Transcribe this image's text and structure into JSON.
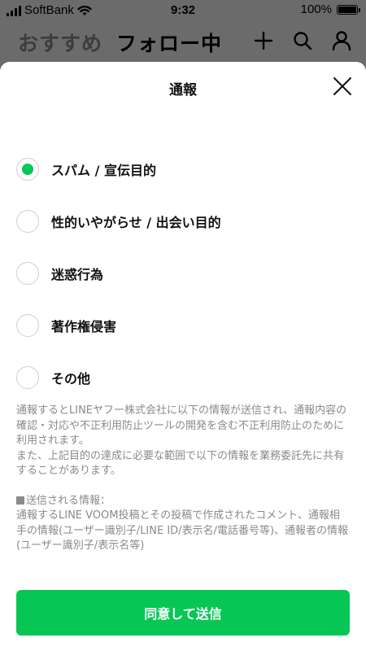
{
  "status_bar": {
    "carrier": "SoftBank",
    "time": "9:32",
    "battery": "100%",
    "battery_level": 1.0
  },
  "background_header": {
    "tabs": [
      "おすすめ",
      "フォロー中"
    ],
    "active_tab": "フォロー中",
    "icons": [
      "plus-icon",
      "search-icon",
      "person-icon"
    ]
  },
  "sheet": {
    "title": "通報",
    "options": [
      {
        "label": "スパム / 宣伝目的",
        "selected": true
      },
      {
        "label": "性的いやがらせ / 出会い目的",
        "selected": false
      },
      {
        "label": "迷惑行為",
        "selected": false
      },
      {
        "label": "著作権侵害",
        "selected": false
      },
      {
        "label": "その他",
        "selected": false
      }
    ],
    "notice": {
      "paragraph1": "通報するとLINEヤフー株式会社に以下の情報が送信され、通報内容の確認・対応や不正利用防止ツールの開発を含む不正利用防止のために利用されます。",
      "paragraph2": "また、上記目的の達成に必要な範囲で以下の情報を業務委託先に共有することがあります。",
      "info_heading": "送信される情報：",
      "info_body": "通報するLINE VOOM投稿とその投稿で作成されたコメント、通報相手の情報(ユーザー識別子/LINE ID/表示名/電話番号等)、通報者の情報(ユーザー識別子/表示名等)"
    },
    "submit_label": "同意して送信"
  },
  "colors": {
    "accent": "#06c755",
    "overlay": "#6b6b6b",
    "muted_text": "#8a8a8a"
  }
}
